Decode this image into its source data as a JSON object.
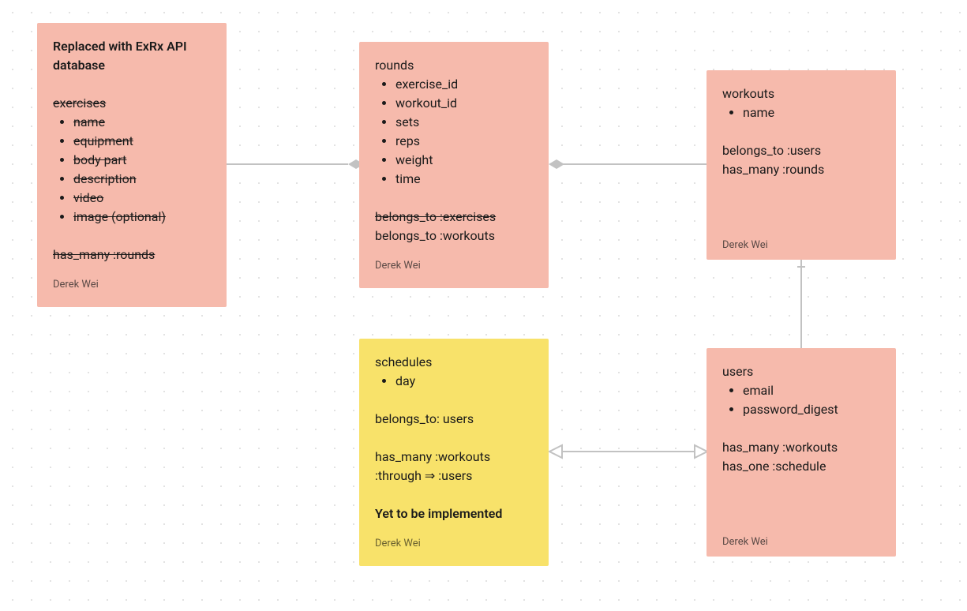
{
  "author": "Derek Wei",
  "cards": {
    "exercises": {
      "title_bold": "Replaced with ExRx API database",
      "model": "exercises",
      "fields": [
        "name",
        "equipment",
        "body part",
        "description",
        "video",
        "image (optional)"
      ],
      "relations": [
        "has_many :rounds"
      ]
    },
    "rounds": {
      "model": "rounds",
      "fields": [
        "exercise_id",
        "workout_id",
        "sets",
        "reps",
        "weight",
        "time"
      ],
      "relations_strike": "belongs_to :exercises",
      "relations2": "belongs_to :workouts"
    },
    "workouts": {
      "model": "workouts",
      "fields": [
        "name"
      ],
      "relations": [
        "belongs_to :users",
        "has_many :rounds"
      ]
    },
    "schedules": {
      "model": "schedules",
      "fields": [
        "day"
      ],
      "rel1": "belongs_to: users",
      "rel2a": "has_many :workouts",
      "rel2b": ":through ⇒ :users",
      "note_bold": "Yet to be implemented"
    },
    "users": {
      "model": "users",
      "fields": [
        "email",
        "password_digest"
      ],
      "relations": [
        "has_many :workouts",
        "has_one :schedule"
      ]
    }
  }
}
